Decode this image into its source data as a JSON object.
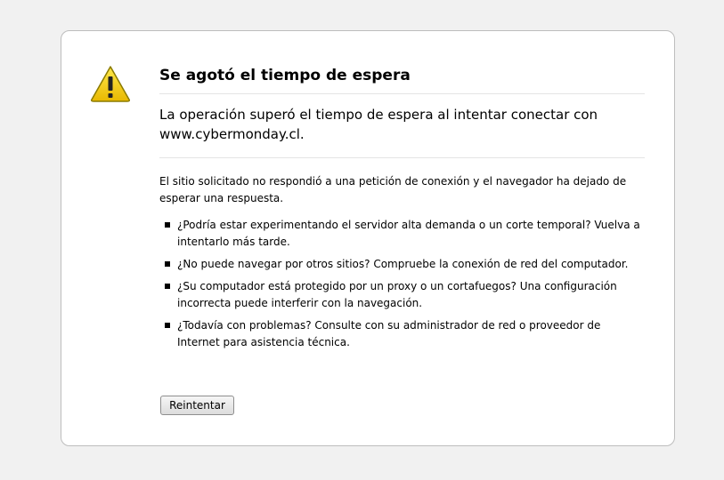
{
  "error": {
    "title": "Se agotó el tiempo de espera",
    "short_desc": "La operación superó el tiempo de espera al intentar conectar con www.cybermonday.cl.",
    "long_desc": "El sitio solicitado no respondió a una petición de conexión y el navegador ha dejado de esperar una respuesta.",
    "suggestions": [
      "¿Podría estar experimentando el servidor alta demanda o un corte temporal? Vuelva a intentarlo más tarde.",
      "¿No puede navegar por otros sitios? Compruebe la conexión de red del computador.",
      "¿Su computador está protegido por un proxy o un cortafuegos? Una configuración incorrecta puede interferir con la navegación.",
      "¿Todavía con problemas? Consulte con su administrador de red o proveedor de Internet para asistencia técnica."
    ],
    "retry_label": "Reintentar",
    "icon": "warning-icon",
    "colors": {
      "icon_fill": "#f5d200",
      "icon_stroke": "#8a7a00",
      "background": "#f1f1f1",
      "panel": "#ffffff"
    }
  }
}
